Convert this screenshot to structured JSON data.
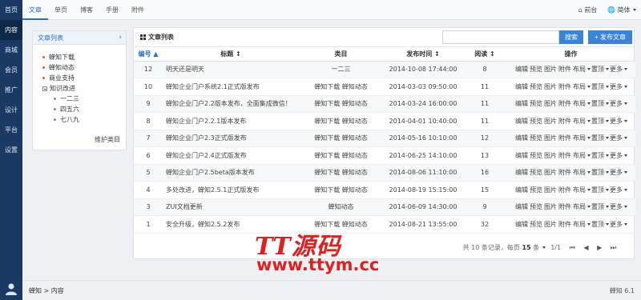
{
  "sidebar": {
    "items": [
      "首页",
      "内容",
      "商城",
      "会员",
      "推广",
      "设计",
      "平台",
      "设置"
    ],
    "active": "内容"
  },
  "topbar": {
    "tabs": [
      "文章",
      "单页",
      "博客",
      "手册",
      "附件"
    ],
    "active": "文章",
    "front_label": "前台",
    "lang_label": "简体"
  },
  "catpanel": {
    "title": "文章列表",
    "nodes": [
      "蝉知下载",
      "蝉知动态",
      "商业支持",
      "知识改进"
    ],
    "subnodes": [
      "一二三",
      "四五六",
      "七八九"
    ],
    "maintain": "维护类目"
  },
  "main": {
    "title": "文章列表",
    "search_placeholder": "",
    "search_button": "搜索",
    "new_button": "+ 发布文章",
    "columns": [
      "编号",
      "标题",
      "类目",
      "发布时间",
      "阅读",
      "操作"
    ],
    "rows": [
      {
        "id": "12",
        "title": "明天还是明天",
        "cat": "一二三",
        "time": "2014-10-08 17:44:00",
        "views": "8"
      },
      {
        "id": "10",
        "title": "蝉知企业门户系统2.1正式版发布",
        "cat": "蝉知下载 蝉知动态",
        "time": "2014-03-03 09:50:00",
        "views": "11"
      },
      {
        "id": "9",
        "title": "蝉知企业门户2.2版本发布，全面集成微信！",
        "cat": "蝉知下载 蝉知动态",
        "time": "2014-03-24 16:00:00",
        "views": "11"
      },
      {
        "id": "8",
        "title": "蝉知企业门户2.2.1版本发布",
        "cat": "蝉知下载 蝉知动态",
        "time": "2014-04-01 10:40:00",
        "views": "11"
      },
      {
        "id": "7",
        "title": "蝉知企业门户2.3正式版发布",
        "cat": "蝉知下载 蝉知动态",
        "time": "2014-05-16 10:10:00",
        "views": "12"
      },
      {
        "id": "6",
        "title": "蝉知企业门户2.4正式版发布",
        "cat": "蝉知下载 蝉知动态",
        "time": "2014-06-25 14:10:00",
        "views": "13"
      },
      {
        "id": "5",
        "title": "蝉知企业门户2.5beta版本发布",
        "cat": "蝉知下载 蝉知动态",
        "time": "2014-08-06 11:10:00",
        "views": "16"
      },
      {
        "id": "4",
        "title": "多处改进，蝉知2.5.1正式版发布",
        "cat": "蝉知下载 蝉知动态",
        "time": "2014-08-19 15:15:00",
        "views": "15"
      },
      {
        "id": "3",
        "title": "ZUI文档更新",
        "cat": "蝉知动态",
        "time": "2014-06-09 14:30:00",
        "views": "9"
      },
      {
        "id": "1",
        "title": "安全升级，蝉知2.5.2发布",
        "cat": "蝉知下载 蝉知动态",
        "time": "2014-08-21 13:55:00",
        "views": "32"
      }
    ],
    "ops": [
      "编辑",
      "预览",
      "图片",
      "附件",
      "布局",
      "置顶",
      "更多"
    ],
    "pager": {
      "total": "共 10 条记录，每页",
      "per_page": "15",
      "unit": "条",
      "page": "1/1"
    }
  },
  "statusbar": {
    "breadcrumb": "蝉知 > 内容",
    "version": "蝉知 6.1"
  },
  "watermark": {
    "line1": "TT源码",
    "line2": "www.ttym.cc"
  }
}
